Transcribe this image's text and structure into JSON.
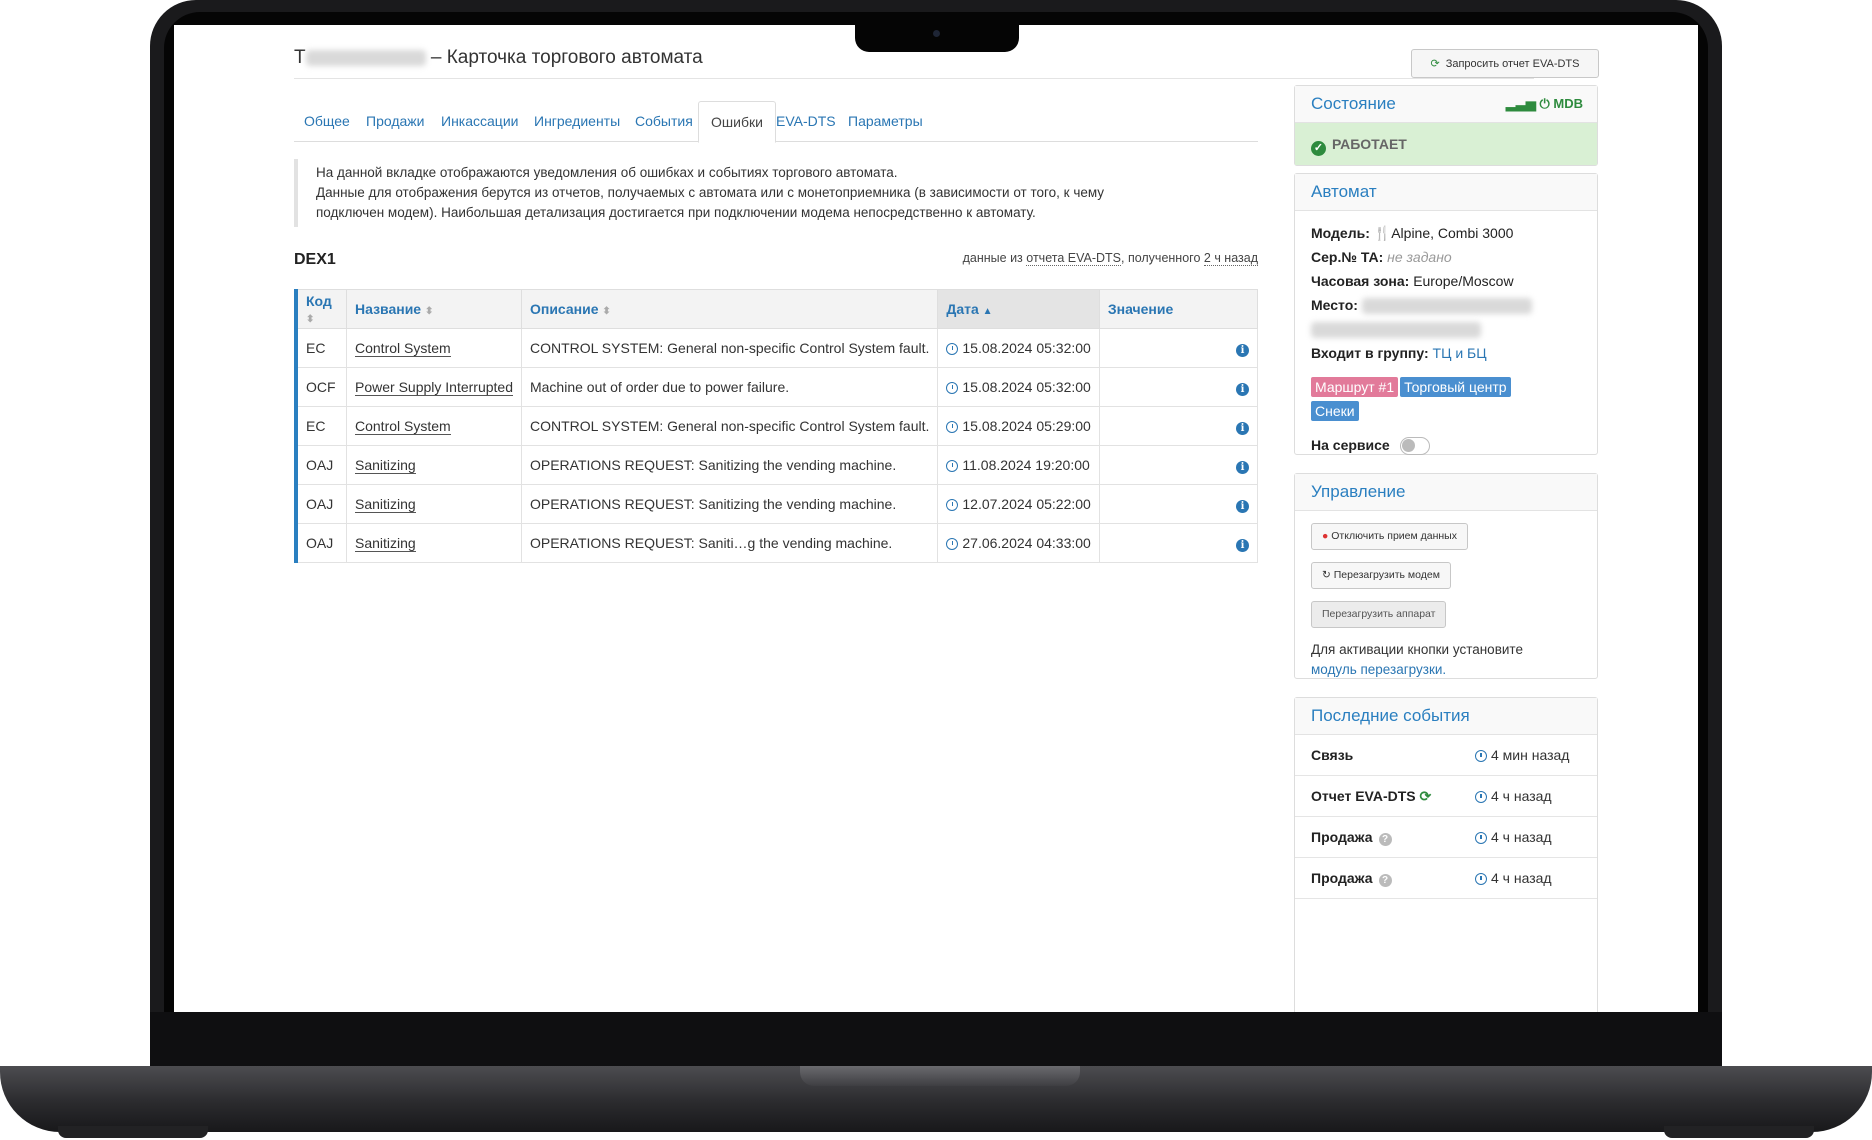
{
  "page": {
    "title_prefix": "Т",
    "title": "– Карточка торгового автомата",
    "request_report_button": "Запросить отчет EVA-DTS"
  },
  "tabs": [
    {
      "label": "Общее"
    },
    {
      "label": "Продажи"
    },
    {
      "label": "Инкассации"
    },
    {
      "label": "Ингредиенты"
    },
    {
      "label": "События"
    },
    {
      "label": "Ошибки"
    },
    {
      "label": "EVA-DTS"
    },
    {
      "label": "Параметры"
    }
  ],
  "active_tab": "Ошибки",
  "note": {
    "line1": "На данной вкладке отображаются уведомления об ошибках и событиях торгового автомата.",
    "line2": "Данные для отображения берутся из отчетов, получаемых с автомата или с монетоприемника (в зависимости от того, к чему",
    "line3": "подключен модем). Наибольшая детализация достигается при подключении модема непосредственно к автомату."
  },
  "dex": {
    "heading": "DEX1",
    "source_prefix": "данные из",
    "source_link": "отчета EVA-DTS",
    "source_suffix": ", полученного",
    "source_time": "2 ч назад"
  },
  "table": {
    "headers": {
      "code": "Код",
      "name": "Название",
      "description": "Описание",
      "date": "Дата",
      "value": "Значение"
    },
    "rows": [
      {
        "code": "EC",
        "name": "Control System",
        "description": "CONTROL SYSTEM: General non-specific Control System fault.",
        "date": "15.08.2024 05:32:00"
      },
      {
        "code": "OCF",
        "name": "Power Supply Interrupted",
        "description": "Machine out of order due to power failure.",
        "date": "15.08.2024 05:32:00"
      },
      {
        "code": "EC",
        "name": "Control System",
        "description": "CONTROL SYSTEM: General non-specific Control System fault.",
        "date": "15.08.2024 05:29:00"
      },
      {
        "code": "OAJ",
        "name": "Sanitizing",
        "description": "OPERATIONS REQUEST: Sanitizing the vending machine.",
        "date": "11.08.2024 19:20:00"
      },
      {
        "code": "OAJ",
        "name": "Sanitizing",
        "description": "OPERATIONS REQUEST: Sanitizing the vending machine.",
        "date": "12.07.2024 05:22:00"
      },
      {
        "code": "OAJ",
        "name": "Sanitizing",
        "description": "OPERATIONS REQUEST: Saniti…g the vending machine.",
        "date": "27.06.2024 04:33:00"
      }
    ]
  },
  "state": {
    "title": "Состояние",
    "interface": "MDB",
    "status": "РАБОТАЕТ"
  },
  "machine": {
    "title": "Автомат",
    "model_label": "Модель:",
    "model_value": "Alpine, Combi 3000",
    "serial_label": "Сер.№ ТА:",
    "serial_value": "не задано",
    "tz_label": "Часовая зона:",
    "tz_value": "Europe/Moscow",
    "place_label": "Место:",
    "group_label": "Входит в группу:",
    "group_value": "ТЦ и БЦ",
    "tags": [
      "Маршрут #1",
      "Торговый центр",
      "Снеки"
    ],
    "service_label": "На сервисе"
  },
  "control": {
    "title": "Управление",
    "btn_disable": "Отключить прием данных",
    "btn_reboot_modem": "Перезагрузить модем",
    "btn_reboot_device": "Перезагрузить аппарат",
    "hint": "Для активации кнопки установите",
    "hint_link": "модуль перезагрузки."
  },
  "events": {
    "title": "Последние события",
    "items": [
      {
        "label": "Связь",
        "time": "4 мин назад"
      },
      {
        "label": "Отчет EVA-DTS",
        "time": "4 ч назад"
      },
      {
        "label": "Продажа",
        "time": "4 ч назад"
      },
      {
        "label": "Продажа",
        "time": "4 ч назад"
      }
    ]
  },
  "colors": {
    "accent": "#2a7fc0",
    "ok_bg": "#d9f0d4",
    "ok": "#2e8b3e",
    "tag_route": "#e27a9a",
    "tag_center": "#4a8fd0",
    "tag_snack": "#4a8fd0"
  }
}
